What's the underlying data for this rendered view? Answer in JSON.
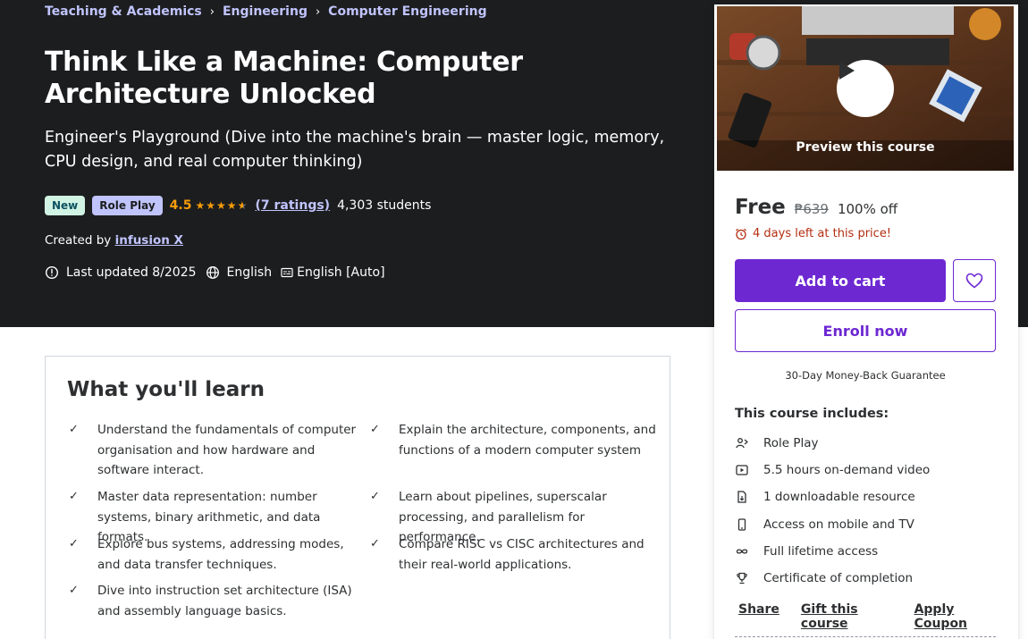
{
  "breadcrumb": [
    "Teaching & Academics",
    "Engineering",
    "Computer Engineering"
  ],
  "course": {
    "title": "Think Like a Machine: Computer Architecture Unlocked",
    "subtitle": "Engineer's Playground (Dive into the machine's brain — master logic, memory, CPU design, and real computer thinking)",
    "badges": {
      "new": "New",
      "role_play": "Role Play"
    },
    "rating": "4.5",
    "ratings_count": "(7 ratings)",
    "students": "4,303 students",
    "created_by_label": "Created by",
    "author": "infusion X",
    "last_updated": "Last updated 8/2025",
    "language": "English",
    "captions": "English [Auto]"
  },
  "learn": {
    "title": "What you'll learn",
    "items": [
      "Understand the fundamentals of computer organisation and how hardware and software interact.",
      "Explain the architecture, components, and functions of a modern computer system",
      "Master data representation: number systems, binary arithmetic, and data formats.",
      "Learn about pipelines, superscalar processing, and parallelism for performance.",
      "Explore bus systems, addressing modes, and data transfer techniques.",
      "Compare RISC vs CISC architectures and their real-world applications.",
      "Dive into instruction set architecture (ISA) and assembly language basics."
    ]
  },
  "sidebar": {
    "preview_label": "Preview this course",
    "price": "Free",
    "original_price": "₱639",
    "discount": "100% off",
    "deadline": "4 days left at this price!",
    "add_to_cart": "Add to cart",
    "enroll": "Enroll now",
    "guarantee": "30-Day Money-Back Guarantee",
    "includes_title": "This course includes:",
    "includes": [
      {
        "icon": "role-play-icon",
        "label": "Role Play"
      },
      {
        "icon": "video-icon",
        "label": "5.5 hours on-demand video"
      },
      {
        "icon": "file-download-icon",
        "label": "1 downloadable resource"
      },
      {
        "icon": "mobile-icon",
        "label": "Access on mobile and TV"
      },
      {
        "icon": "infinity-icon",
        "label": "Full lifetime access"
      },
      {
        "icon": "trophy-icon",
        "label": "Certificate of completion"
      }
    ],
    "links": {
      "share": "Share",
      "gift": "Gift this course",
      "coupon": "Apply Coupon"
    }
  },
  "colors": {
    "hero_bg": "#1c1d1f",
    "accent": "#6d28d2",
    "link_light": "#c0c4fc",
    "rating": "#f69c08",
    "deadline": "#b32d0f"
  }
}
